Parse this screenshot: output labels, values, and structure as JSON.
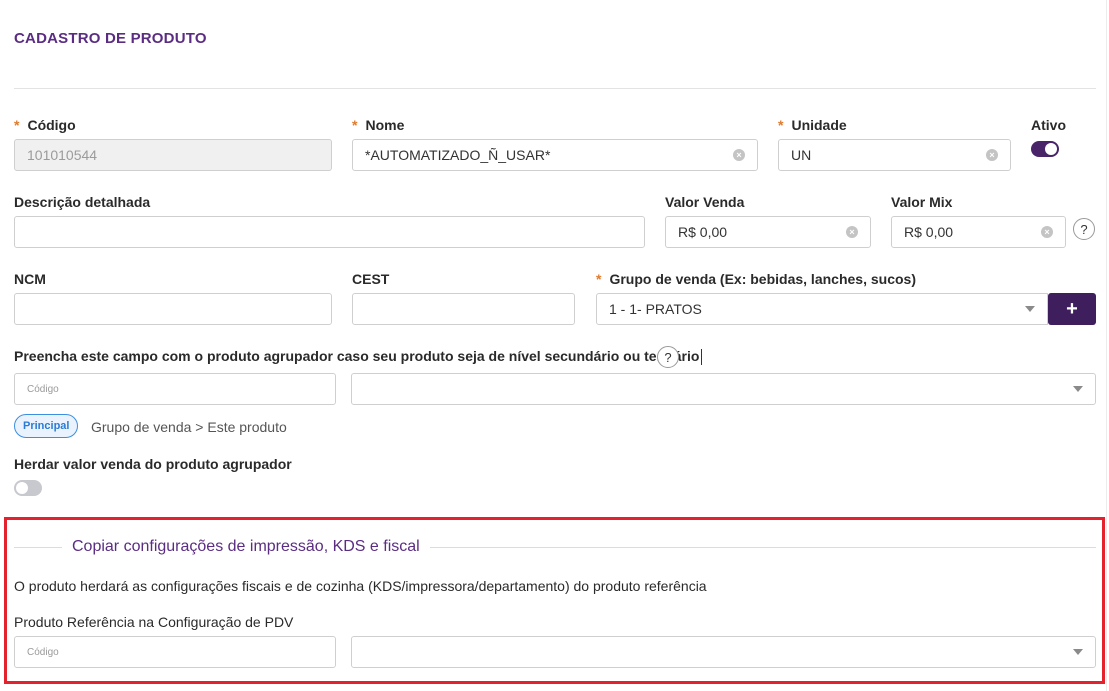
{
  "page": {
    "title": "CADASTRO DE PRODUTO"
  },
  "fields": {
    "codigo": {
      "label": "Código",
      "value": "101010544"
    },
    "nome": {
      "label": "Nome",
      "value": "*AUTOMATIZADO_Ñ_USAR*"
    },
    "unidade": {
      "label": "Unidade",
      "value": "UN"
    },
    "ativo": {
      "label": "Ativo",
      "enabled": true
    },
    "descricao": {
      "label": "Descrição detalhada",
      "value": ""
    },
    "valor_venda": {
      "label": "Valor Venda",
      "value": "R$ 0,00"
    },
    "valor_mix": {
      "label": "Valor Mix",
      "value": "R$ 0,00"
    },
    "ncm": {
      "label": "NCM",
      "value": ""
    },
    "cest": {
      "label": "CEST",
      "value": ""
    },
    "grupo_venda": {
      "label": "Grupo de venda (Ex: bebidas, lanches, sucos)",
      "value": "1 - 1- PRATOS",
      "add_label": "+"
    },
    "agrupador": {
      "label": "Preencha este campo com o produto agrupador caso seu produto seja de nível secundário ou terciário",
      "code_placeholder": "Código",
      "select_value": ""
    },
    "hierarchy": {
      "badge": "Principal",
      "path": "Grupo de venda > Este produto"
    },
    "herdar": {
      "label": "Herdar valor venda do produto agrupador",
      "enabled": false
    }
  },
  "copy_section": {
    "title": "Copiar configurações de impressão, KDS e fiscal",
    "description": "O produto herdará as configurações fiscais e de cozinha (KDS/impressora/departamento) do produto referência",
    "ref_label": "Produto Referência na Configuração de PDV",
    "code_placeholder": "Código",
    "select_value": ""
  },
  "icons": {
    "clear": "clear-circle-icon",
    "dropdown": "chevron-down-icon",
    "help": "question-mark-icon",
    "add": "plus-icon"
  },
  "colors": {
    "brand": "#5b2d82",
    "toggle_on": "#4a2469",
    "required": "#e07b2e",
    "highlight": "#e4222e",
    "badge": "#2a7bd3"
  },
  "help_glyph": "?",
  "clear_glyph": "×"
}
